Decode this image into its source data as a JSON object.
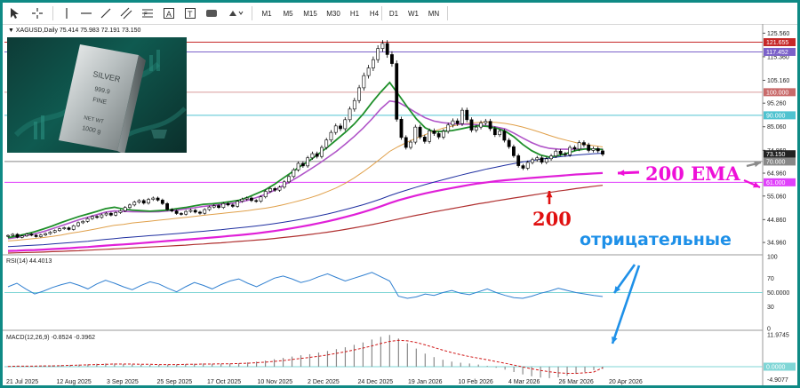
{
  "toolbar": {
    "timeframes": [
      "M1",
      "M5",
      "M15",
      "M30",
      "H1",
      "H4",
      "D1",
      "W1",
      "MN"
    ]
  },
  "chart_data": {
    "type": "line",
    "symbol_header": "XAGUSD,Daily  75.414 75.983 72.191 73.150",
    "x_dates": [
      "21 Jul 2025",
      "12 Aug 2025",
      "3 Sep 2025",
      "25 Sep 2025",
      "17 Oct 2025",
      "10 Nov 2025",
      "2 Dec 2025",
      "24 Dec 2025",
      "19 Jan 2026",
      "10 Feb 2026",
      "4 Mar 2026",
      "26 Mar 2026",
      "20 Apr 2026"
    ],
    "price_axis": {
      "ticks": [
        "125.560",
        "115.360",
        "105.160",
        "95.260",
        "85.060",
        "74.860",
        "64.960",
        "55.060",
        "44.860",
        "34.960"
      ],
      "range": [
        30,
        128
      ]
    },
    "price_tags": [
      {
        "label": "121.655",
        "value": 121.655,
        "color": "#c62828"
      },
      {
        "label": "117.452",
        "value": 117.452,
        "color": "#7b61c9"
      },
      {
        "label": "100.000",
        "value": 100,
        "color": "#c96a6a"
      },
      {
        "label": "90.000",
        "value": 90,
        "color": "#4fc3d0"
      },
      {
        "label": "73.150",
        "value": 73.15,
        "color": "#222222"
      },
      {
        "label": "70.000",
        "value": 70,
        "color": "#888888"
      },
      {
        "label": "61.000",
        "value": 61,
        "color": "#e040fb"
      }
    ],
    "horizontal_levels": [
      {
        "value": 121.655,
        "color": "#c62828"
      },
      {
        "value": 117.452,
        "color": "#7b61c9"
      },
      {
        "value": 100,
        "color": "#d99a9a"
      },
      {
        "value": 90,
        "color": "#4fc3d0"
      },
      {
        "value": 70,
        "color": "#888888"
      },
      {
        "value": 61,
        "color": "#e040fb"
      }
    ],
    "closes": [
      38,
      38.5,
      37.2,
      37.8,
      38.6,
      38.1,
      37.5,
      38.2,
      38.8,
      39.4,
      40.1,
      40.9,
      41.3,
      40.6,
      42.2,
      43.5,
      44.1,
      45.3,
      46.2,
      45.8,
      46.9,
      47.6,
      46.8,
      47.9,
      48.7,
      50.1,
      51.2,
      52.4,
      53.1,
      52.0,
      53.6,
      54.2,
      53.3,
      51.8,
      49.2,
      48.6,
      47.5,
      47.2,
      48.4,
      48.9,
      48.1,
      47.6,
      49.2,
      50.3,
      50.9,
      50.1,
      51.8,
      51.2,
      50.6,
      52.8,
      53.7,
      54.2,
      53.1,
      52.8,
      54.7,
      57.1,
      58.3,
      57.6,
      58.9,
      61.2,
      63.5,
      66.4,
      69.2,
      68.1,
      71.6,
      73.4,
      72.2,
      76.1,
      79.3,
      82.6,
      85.4,
      84.2,
      88.1,
      92.7,
      96.4,
      101.9,
      107.2,
      110.5,
      114.1,
      118.9,
      121.1,
      116.3,
      112.4,
      88.3,
      80.4,
      76.1,
      78.4,
      84.9,
      80.6,
      78.7,
      83.3,
      82.1,
      80.6,
      83.1,
      85.8,
      87.6,
      86.4,
      92.2,
      88.1,
      83.6,
      84.9,
      86.7,
      87.4,
      84.2,
      81.6,
      83.1,
      79.2,
      76.4,
      72.5,
      68.2,
      67.1,
      69.6,
      70.8,
      71.6,
      69.7,
      71.2,
      72.4,
      74.5,
      73.3,
      72.9,
      76.1,
      75.4,
      78.2,
      77.2,
      74.8,
      75.6,
      74.6,
      73.15
    ],
    "ema_green": [
      37,
      37.8,
      38.6,
      39.6,
      40.8,
      42.1,
      43.6,
      44.9,
      46.2,
      47.3,
      48.4,
      49.6,
      50.2,
      49.4,
      49,
      48.7,
      48.5,
      48.7,
      49,
      49.6,
      50.1,
      50.8,
      51.5,
      51.7,
      52.1,
      52.6,
      53.2,
      54.5,
      56.1,
      57.8,
      60.1,
      62.8,
      65.4,
      68.1,
      70.5,
      73.3,
      76.2,
      79.4,
      82.6,
      86.2,
      90.5,
      95.5,
      100.1,
      104.2,
      99,
      93.6,
      88.5,
      84.6,
      82.8,
      83.1,
      83.4,
      84.1,
      84.9,
      85.5,
      85.2,
      84.5,
      83.2,
      80.7,
      77.4,
      74.7,
      72.8,
      71.9,
      72.6,
      73.6,
      74.8,
      75.4,
      75.4,
      75.2
    ],
    "ema_purple": [
      36.6,
      37.2,
      37.9,
      38.7,
      39.7,
      40.9,
      42.2,
      43.5,
      44.8,
      45.9,
      47,
      48.1,
      48.6,
      48.4,
      48.3,
      48.2,
      48.2,
      48.3,
      48.6,
      49,
      49.5,
      50,
      50.6,
      51,
      51.4,
      51.8,
      52.3,
      53.2,
      54.4,
      55.8,
      57.5,
      59.6,
      61.8,
      64.1,
      66.5,
      69,
      71.7,
      74.4,
      77.5,
      80.8,
      84.4,
      88.4,
      92.8,
      96.2,
      95.6,
      93.5,
      91.1,
      88.9,
      87.5,
      86.8,
      86.4,
      86.2,
      86.1,
      85.9,
      85.5,
      84.9,
      84.1,
      82.3,
      80.2,
      78.2,
      76.6,
      75.7,
      75.4,
      75.3,
      75.4,
      75.5,
      75.4,
      75.3
    ],
    "sma_orange": [
      35.6,
      35.9,
      36.3,
      36.7,
      37.1,
      37.6,
      38.2,
      38.9,
      39.5,
      40.2,
      40.9,
      41.7,
      42.4,
      42.8,
      43.4,
      43.8,
      44.2,
      44.6,
      45,
      45.4,
      45.8,
      46.2,
      46.7,
      47.1,
      47.5,
      47.9,
      48.3,
      48.7,
      49.3,
      49.8,
      50.5,
      51.3,
      52.2,
      53.2,
      54.3,
      55.5,
      57,
      58.6,
      60.6,
      62.9,
      65.5,
      68.3,
      71.3,
      74.4,
      76.5,
      78.4,
      80.1,
      81.6,
      83.1,
      84.4,
      85.3,
      86.1,
      86.6,
      86.9,
      87.1,
      86.9,
      86.5,
      85.8,
      84.9,
      83.8,
      82.6,
      81.3,
      80.1,
      79.1,
      78.2,
      77.4,
      76.9,
      76.3
    ],
    "sma_navy": [
      33.2,
      33.4,
      33.6,
      33.8,
      34,
      34.3,
      34.6,
      34.9,
      35.2,
      35.5,
      35.9,
      36.3,
      36.6,
      37,
      37.3,
      37.6,
      37.9,
      38.2,
      38.5,
      38.8,
      39.1,
      39.5,
      39.8,
      40.2,
      40.5,
      40.9,
      41.3,
      41.7,
      42.1,
      42.6,
      43.1,
      43.7,
      44.3,
      45,
      45.7,
      46.5,
      47.3,
      48.2,
      49.2,
      50.2,
      51.3,
      52.5,
      53.8,
      55.2,
      56.5,
      57.7,
      58.9,
      60,
      61.1,
      62.1,
      63.1,
      64.1,
      65,
      65.9,
      66.8,
      67.6,
      68.4,
      69.1,
      69.8,
      70.4,
      71,
      71.5,
      72,
      72.4,
      72.8,
      73.1,
      73.4,
      73.6
    ],
    "ema200_magenta": [
      31.3,
      31.4,
      31.6,
      31.7,
      31.9,
      32.1,
      32.3,
      32.5,
      32.8,
      33,
      33.3,
      33.6,
      33.9,
      34.1,
      34.4,
      34.7,
      35,
      35.3,
      35.6,
      35.9,
      36.2,
      36.5,
      36.8,
      37.1,
      37.4,
      37.8,
      38.1,
      38.5,
      38.9,
      39.4,
      39.9,
      40.5,
      41.1,
      41.8,
      42.5,
      43.3,
      44.1,
      45,
      46,
      47,
      48.1,
      49.3,
      50.6,
      52,
      53.2,
      54.3,
      55.3,
      56.2,
      57,
      57.8,
      58.5,
      59.2,
      59.9,
      60.5,
      61,
      61.5,
      61.9,
      62.2,
      62.6,
      62.9,
      63.2,
      63.5,
      63.8,
      64.1,
      64.4,
      64.6,
      64.8,
      65
    ],
    "sma200_darkred": [
      30.4,
      30.5,
      30.6,
      30.7,
      30.8,
      31,
      31.1,
      31.3,
      31.4,
      31.6,
      31.8,
      32,
      32.2,
      32.4,
      32.6,
      32.8,
      33,
      33.2,
      33.4,
      33.6,
      33.8,
      34.1,
      34.3,
      34.6,
      34.8,
      35.1,
      35.4,
      35.7,
      36,
      36.3,
      36.7,
      37.1,
      37.5,
      37.9,
      38.4,
      38.9,
      39.4,
      40,
      40.6,
      41.3,
      42,
      42.7,
      43.5,
      44.3,
      45.1,
      45.9,
      46.7,
      47.4,
      48.2,
      48.9,
      49.6,
      50.3,
      51,
      51.7,
      52.3,
      53,
      53.6,
      54.2,
      54.8,
      55.4,
      56,
      56.6,
      57.2,
      57.7,
      58.3,
      58.8,
      59.3,
      59.7
    ],
    "rsi": {
      "header": "RSI(14) 44.4013",
      "ticks": [
        "100",
        "70",
        "50.0000",
        "30",
        "0"
      ],
      "level_value": 50,
      "values": [
        58,
        63,
        55,
        48,
        52,
        57,
        61,
        64,
        60,
        55,
        62,
        67,
        63,
        58,
        54,
        60,
        65,
        62,
        56,
        51,
        58,
        64,
        60,
        55,
        61,
        66,
        69,
        63,
        58,
        64,
        70,
        73,
        69,
        64,
        67,
        72,
        76,
        71,
        66,
        70,
        74,
        78,
        72,
        66,
        45,
        42,
        44,
        48,
        46,
        50,
        53,
        49,
        47,
        51,
        55,
        50,
        46,
        43,
        42,
        45,
        49,
        52,
        56,
        53,
        50,
        48,
        46,
        44.4
      ]
    },
    "macd": {
      "header": "MACD(12,26,9) -0.8524 -0.3962",
      "ticks": [
        "11.9745",
        "0.0000",
        "-4.9077"
      ],
      "histogram": [
        0.2,
        0.3,
        0.3,
        0.2,
        0.4,
        0.5,
        0.6,
        0.7,
        0.8,
        0.9,
        1.1,
        1.2,
        1.2,
        1.0,
        0.9,
        0.8,
        0.7,
        0.7,
        0.8,
        0.9,
        1.0,
        1.1,
        1.2,
        1.1,
        1.1,
        1.2,
        1.3,
        1.6,
        1.9,
        2.3,
        2.8,
        3.3,
        3.8,
        4.3,
        4.7,
        5.3,
        5.9,
        6.6,
        7.3,
        8.2,
        9.1,
        10.2,
        11.2,
        11.9,
        10.6,
        8.8,
        6.8,
        4.9,
        3.6,
        2.6,
        1.9,
        1.5,
        1.2,
        0.8,
        0.3,
        -0.4,
        -1.1,
        -2.0,
        -2.9,
        -3.6,
        -4.1,
        -4.3,
        -4.0,
        -3.4,
        -2.7,
        -2.0,
        -1.3,
        -0.85
      ],
      "signal": [
        0.1,
        0.2,
        0.2,
        0.2,
        0.3,
        0.3,
        0.4,
        0.5,
        0.6,
        0.7,
        0.8,
        0.9,
        1.0,
        1.0,
        1.0,
        0.9,
        0.9,
        0.8,
        0.8,
        0.8,
        0.9,
        0.9,
        1.0,
        1.0,
        1.1,
        1.1,
        1.2,
        1.3,
        1.5,
        1.7,
        2.0,
        2.3,
        2.7,
        3.1,
        3.5,
        3.9,
        4.4,
        5.0,
        5.6,
        6.3,
        7.0,
        7.8,
        8.7,
        9.5,
        9.9,
        9.7,
        9.1,
        8.2,
        7.2,
        6.2,
        5.3,
        4.5,
        3.8,
        3.2,
        2.6,
        1.9,
        1.3,
        0.6,
        -0.1,
        -0.8,
        -1.4,
        -1.9,
        -2.3,
        -2.5,
        -2.5,
        -2.3,
        -2.0,
        -0.4
      ]
    }
  },
  "annotations": {
    "ema200_label": "200 EMA",
    "sma200_label": "200",
    "negative_label": "отрицательные"
  },
  "thumbnail": {
    "bar_line1": "SILVER",
    "bar_line2": "999.9",
    "bar_line3": "FINE",
    "bar_line4": "NET WT",
    "bar_line5": "1000 g"
  },
  "colors": {
    "frame": "#0f8a85",
    "up_candle": "#ffffff",
    "candle_outline": "#000000",
    "ema_green": "#1f8f2a",
    "ema_purple": "#b054c8",
    "sma_orange": "#e0a04a",
    "sma_navy": "#1f2fa0",
    "ema200": "#e020d8",
    "sma200": "#b03030",
    "rsi_line": "#2f7fd0",
    "annotation_magenta": "#ee10d8",
    "annotation_red": "#e01010",
    "annotation_blue": "#1e90e8"
  }
}
